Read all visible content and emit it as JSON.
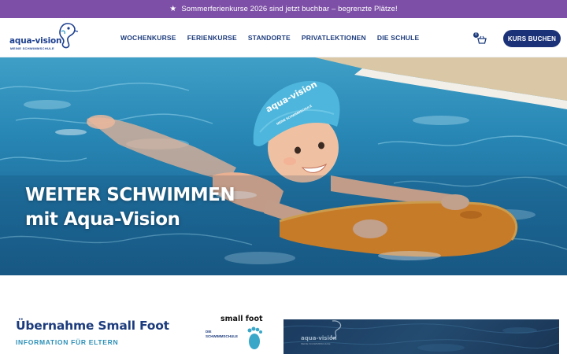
{
  "announcement": {
    "icon": "star-icon",
    "text": "Sommerferienkurse 2026 sind jetzt buchbar – begrenzte Plätze!"
  },
  "header": {
    "logo_text": "aqua-vision",
    "logo_tagline": "MEINE SCHWIMMSCHULE",
    "nav": [
      {
        "label": "WOCHENKURSE"
      },
      {
        "label": "FERIENKURSE"
      },
      {
        "label": "STANDORTE"
      },
      {
        "label": "PRIVATLEKTIONEN"
      },
      {
        "label": "DIE SCHULE"
      }
    ],
    "cart_count": "0",
    "cta_label": "KURS BUCHEN"
  },
  "hero": {
    "title_line1": "WEITER SCHWIMMEN",
    "title_line2": "mit Aqua-Vision",
    "cap_text": "aqua-vision",
    "cap_tagline": "MEINE SCHWIMMSCHULE"
  },
  "section": {
    "title": "Übernahme Small Foot",
    "subtitle": "INFORMATION FÜR ELTERN",
    "partner_logo_text": "small foot",
    "partner_logo_sub1": "DIE",
    "partner_logo_sub2": "SCHWIMMSCHULE",
    "video_logo_text": "aqua-vision",
    "video_logo_tagline": "MEINE SCHWIMMSCHULE"
  },
  "colors": {
    "announcement_bg": "#7d4fa6",
    "brand_navy": "#1d3c7d",
    "cta_bg": "#1c3278",
    "accent_teal": "#2b8fb7"
  }
}
